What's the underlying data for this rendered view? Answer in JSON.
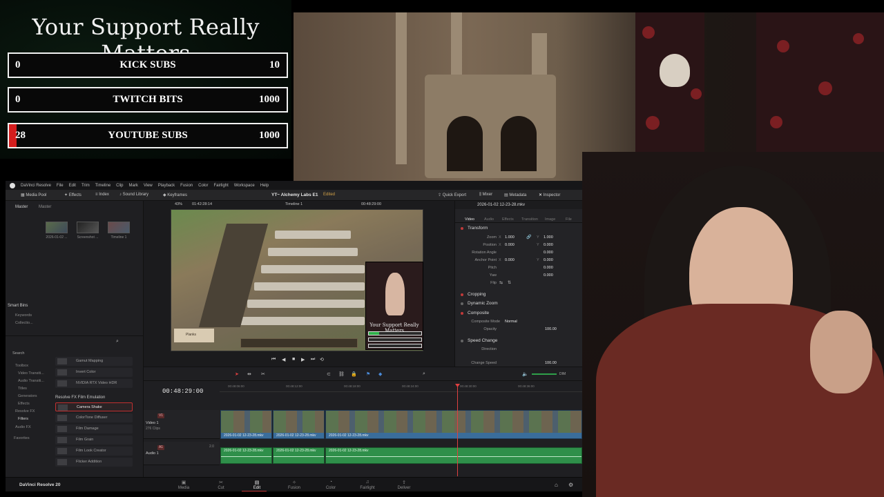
{
  "overlay": {
    "title": "Your Support Really Matters",
    "goals": [
      {
        "current": "0",
        "label": "KICK SUBS",
        "max": "10",
        "progress": 0.0
      },
      {
        "current": "0",
        "label": "TWITCH BITS",
        "max": "1000",
        "progress": 0.0
      },
      {
        "current": "28",
        "label": "YOUTUBE SUBS",
        "max": "1000",
        "progress": 0.028
      }
    ]
  },
  "resolve": {
    "menu": [
      "DaVinci Resolve",
      "File",
      "Edit",
      "Trim",
      "Timeline",
      "Clip",
      "Mark",
      "View",
      "Playback",
      "Fusion",
      "Color",
      "Fairlight",
      "Workspace",
      "Help"
    ],
    "toolbar": {
      "media_pool": "Media Pool",
      "effects": "Effects",
      "index": "Index",
      "sound_library": "Sound Library",
      "keyframes": "Keyframes",
      "project_name": "YT~ Alchemy Labs E1",
      "project_status": "Edited",
      "quick_export": "Quick Export",
      "mixer": "Mixer",
      "metadata": "Metadata",
      "inspector": "Inspector"
    },
    "media_pool": {
      "tabs": [
        "Master",
        "Master"
      ],
      "clips": [
        "2026-01-02 ...",
        "Screenshot ...",
        "Timeline 1"
      ],
      "smart_bins_label": "Smart Bins",
      "smart_bins": [
        "Keywords",
        "Collectio..."
      ]
    },
    "viewer": {
      "zoom": "43%",
      "source_timecode": "01:42:28:14",
      "timeline_name": "Timeline 1",
      "record_timecode": "00:48:29:00",
      "inset_title": "Your Support Really Matters",
      "sign_text": "Planks"
    },
    "inspector": {
      "file": "2026-01-02 12-23-28.mkv",
      "tabs": [
        "Video",
        "Audio",
        "Effects",
        "Transition",
        "Image",
        "File"
      ],
      "transform_label": "Transform",
      "zoom_label": "Zoom",
      "zoom_x": "1.000",
      "zoom_y": "1.000",
      "position_label": "Position",
      "position_x": "0.000",
      "position_y": "0.000",
      "rotation_label": "Rotation Angle",
      "rotation": "0.000",
      "anchor_label": "Anchor Point",
      "anchor_x": "0.000",
      "anchor_y": "0.000",
      "pitch_label": "Pitch",
      "pitch": "0.000",
      "yaw_label": "Yaw",
      "yaw": "0.000",
      "flip_label": "Flip",
      "cropping_label": "Cropping",
      "dynamic_zoom_label": "Dynamic Zoom",
      "composite_label": "Composite",
      "composite_mode_label": "Composite Mode",
      "composite_mode": "Normal",
      "opacity_label": "Opacity",
      "opacity": "100.00",
      "speed_change_label": "Speed Change",
      "direction_label": "Direction",
      "change_speed_label": "Change Speed",
      "change_speed": "100.00"
    },
    "effects_panel": {
      "search_label": "Search",
      "categories": [
        "Toolbox",
        "Video Transiti...",
        "Audio Transiti...",
        "Titles",
        "Generators",
        "Effects",
        "Resolve FX",
        "Filters",
        "Audio FX",
        "Favorites"
      ],
      "items_top": [
        "Gamut Mapping",
        "Invert Color",
        "NVIDIA RTX Video HDR"
      ],
      "group_label": "Resolve FX Film Emulation",
      "items": [
        "Camera Shake",
        "ColorTone Diffuser",
        "Film Damage",
        "Film Grain",
        "Film Look Creator",
        "Flicker Addition"
      ]
    },
    "timeline": {
      "timecode": "00:48:29:00",
      "ruler": [
        "00:48:06:00",
        "00:48:12:00",
        "00:48:18:00",
        "00:48:24:00",
        "00:48:30:00",
        "00:48:36:00"
      ],
      "volume_label": "DIM",
      "video_track": {
        "badge": "V1",
        "name": "Video 1",
        "sub": "276 Clips"
      },
      "audio_track": {
        "badge": "A1",
        "name": "Audio 1",
        "sub": "2.0"
      },
      "video_clips": [
        "2026-01-02 12-23-28.mkv",
        "2026-01-02 12-23-28.mkv",
        "2026-01-02 12-23-28.mkv"
      ],
      "audio_clips": [
        "2026-01-02 12-23-28.mkv",
        "2026-01-02 12-23-28.mkv",
        "2026-01-02 12-23-28.mkv"
      ]
    },
    "pages": {
      "brand": "DaVinci Resolve 20",
      "tabs": [
        "Media",
        "Cut",
        "Edit",
        "Fusion",
        "Color",
        "Fairlight",
        "Deliver"
      ],
      "active": "Edit"
    }
  }
}
